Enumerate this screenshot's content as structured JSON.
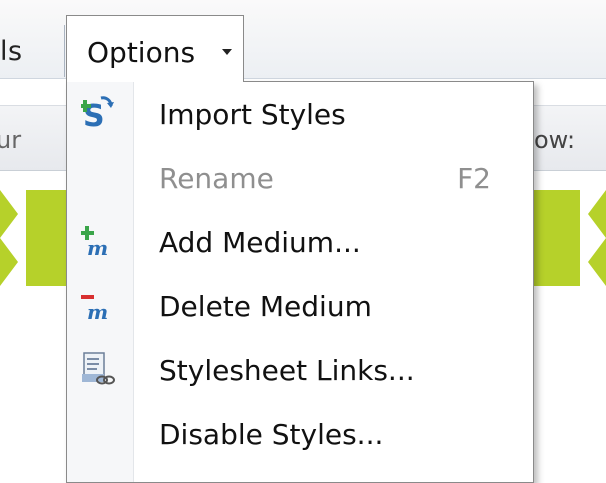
{
  "menubar": {
    "prev_item_partial": "ls",
    "options_label": "Options"
  },
  "subbar": {
    "left_partial": "ur",
    "right_partial": "ow: "
  },
  "menu": {
    "items": [
      {
        "label": "Import Styles",
        "icon": "import-styles-icon",
        "enabled": true
      },
      {
        "label": "Rename",
        "shortcut": "F2",
        "enabled": false
      },
      {
        "label": "Add Medium...",
        "icon": "add-medium-icon",
        "enabled": true
      },
      {
        "label": "Delete Medium",
        "icon": "delete-medium-icon",
        "enabled": true
      },
      {
        "label": "Stylesheet Links...",
        "icon": "stylesheet-links-icon",
        "enabled": true
      },
      {
        "label": "Disable Styles...",
        "enabled": true
      }
    ]
  },
  "colors": {
    "accent_green": "#b6d12a",
    "disabled_text": "#8f8f8f",
    "menu_border": "#8a8a8a"
  }
}
